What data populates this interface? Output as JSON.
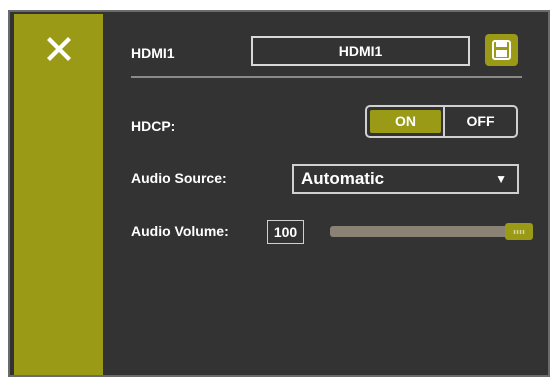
{
  "sidebar": {
    "close_icon": "close-x-icon",
    "accent_color": "#9a9a17"
  },
  "header": {
    "input_label": "HDMI1",
    "input_name_value": "HDMI1",
    "save_icon": "save-floppy-icon"
  },
  "hdcp": {
    "label": "HDCP:",
    "on_label": "ON",
    "off_label": "OFF",
    "selected": "ON"
  },
  "audio_source": {
    "label": "Audio Source:",
    "selected": "Automatic",
    "arrow_icon": "dropdown-triangle-icon"
  },
  "audio_volume": {
    "label": "Audio Volume:",
    "value": "100",
    "level": 100,
    "max": 100
  },
  "colors": {
    "background": "#333333",
    "accent": "#9a9a17",
    "track": "#8a8274",
    "border": "#d0d0d0"
  }
}
